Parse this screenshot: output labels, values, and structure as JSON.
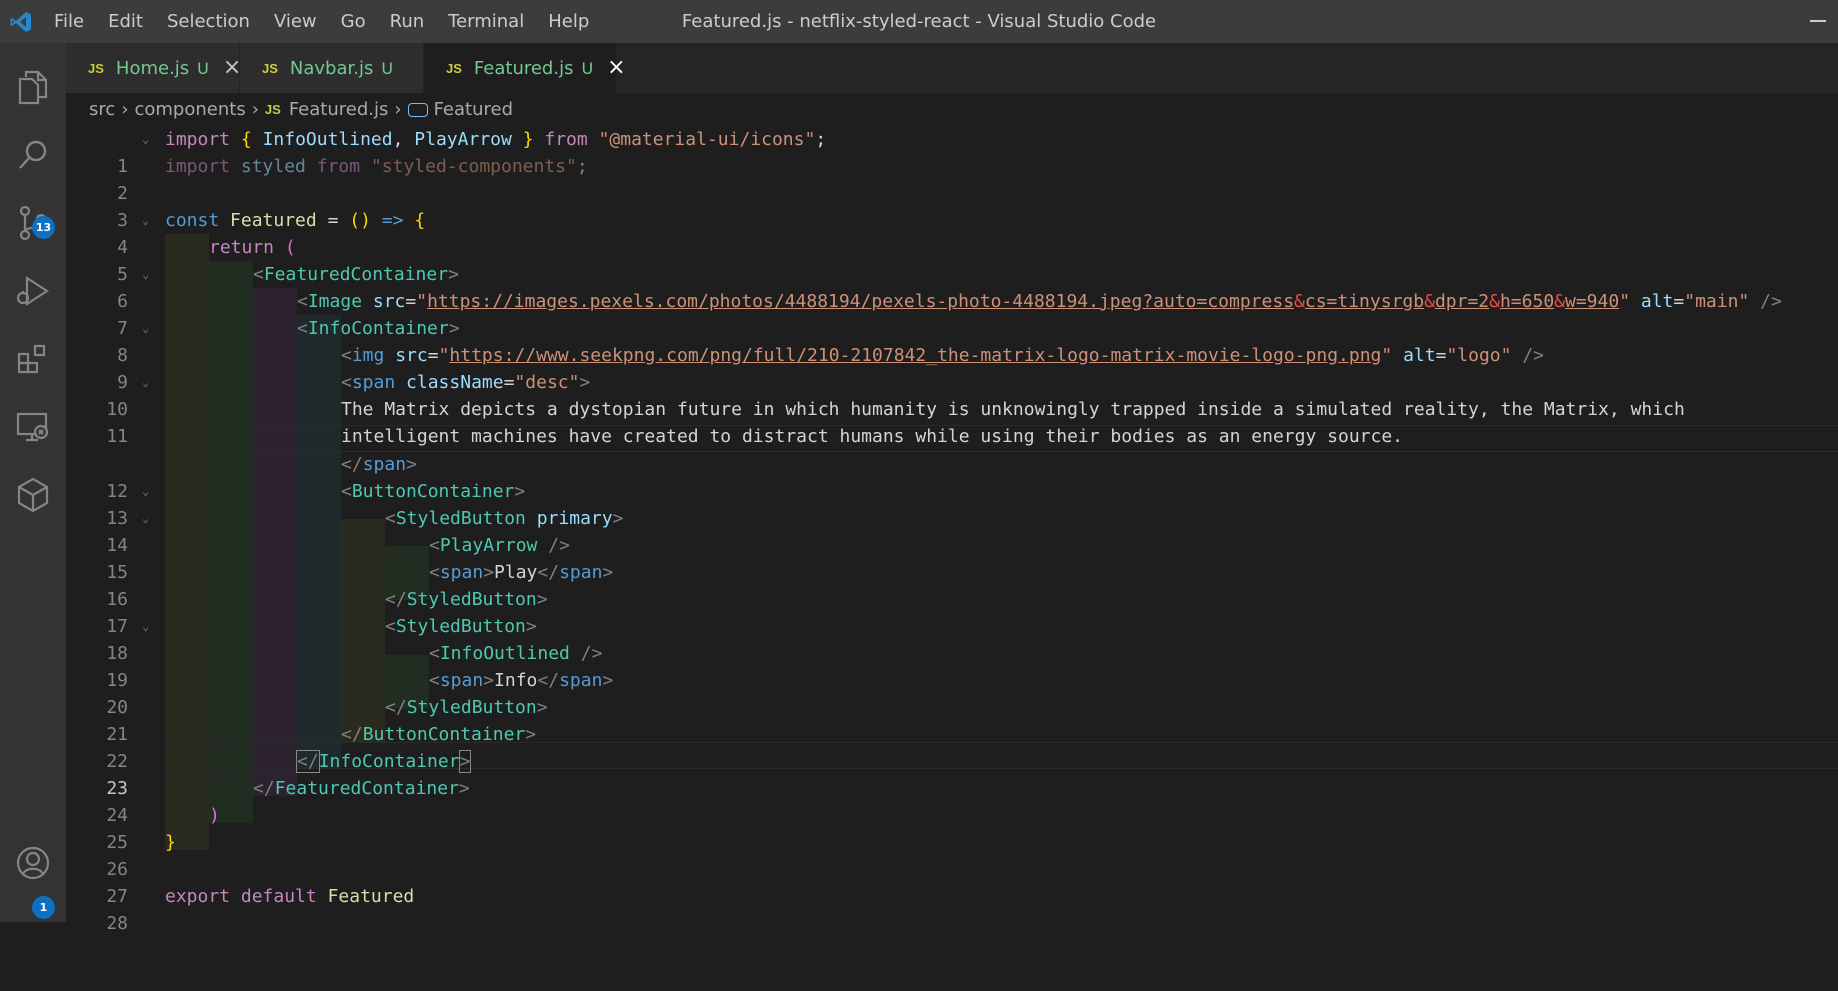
{
  "window": {
    "title": "Featured.js - netflix-styled-react - Visual Studio Code"
  },
  "menu": [
    "File",
    "Edit",
    "Selection",
    "View",
    "Go",
    "Run",
    "Terminal",
    "Help"
  ],
  "activity": {
    "scm_badge": "13",
    "account_badge": "1"
  },
  "tabs": [
    {
      "label": "Home.js",
      "status": "U",
      "close": "×",
      "icon": "JS"
    },
    {
      "label": "Navbar.js",
      "status": "U",
      "icon": "JS"
    },
    {
      "label": "Featured.js",
      "status": "U",
      "close": "×",
      "icon": "JS"
    }
  ],
  "breadcrumb": {
    "parts": [
      "src",
      "components",
      "Featured.js",
      "Featured"
    ],
    "icon": "JS"
  },
  "editor": {
    "line_numbers": [
      "1",
      "2",
      "3",
      "4",
      "5",
      "6",
      "7",
      "8",
      "9",
      "10",
      "11",
      "12",
      "13",
      "14",
      "15",
      "16",
      "17",
      "18",
      "19",
      "20",
      "21",
      "22",
      "23",
      "24",
      "25",
      "26",
      "27",
      "28"
    ],
    "current_line": "23",
    "code": {
      "l1": {
        "import": "import",
        "ob": "{",
        "a": "InfoOutlined",
        "comma": ",",
        "b": "PlayArrow",
        "cb": "}",
        "from": "from",
        "src": "\"@material-ui/icons\"",
        "semi": ";"
      },
      "l2": {
        "import": "import",
        "name": "styled",
        "from": "from",
        "src": "\"styled-components\"",
        "semi": ";"
      },
      "l4": {
        "const": "const",
        "name": "Featured",
        "eq": "=",
        "paren": "()",
        "arrow": "=>",
        "brace": "{"
      },
      "l5": {
        "ret": "return",
        "paren": "("
      },
      "l6": {
        "lt": "<",
        "tag": "FeaturedContainer",
        "gt": ">"
      },
      "l7": {
        "lt": "<",
        "tag": "Image",
        "attr": "src",
        "eq": "=",
        "q1": "\"",
        "u1": "https://images.pexels.com/photos/4488194/pexels-photo-4488194.jpeg?auto=compress",
        "e1": "&",
        "u2": "cs=tinysrgb",
        "e2": "&",
        "u3": "dpr=2",
        "e3": "&",
        "u4": "h=650",
        "e4": "&",
        "u5": "w=940",
        "q2": "\"",
        "attr2": "alt",
        "eq2": "=",
        "val2": "\"main\"",
        "end": "/>"
      },
      "l8": {
        "lt": "<",
        "tag": "InfoContainer",
        "gt": ">"
      },
      "l9": {
        "lt": "<",
        "tag": "img",
        "attr": "src",
        "eq": "=",
        "q1": "\"",
        "url": "https://www.seekpng.com/png/full/210-2107842_the-matrix-logo-matrix-movie-logo-png.png",
        "q2": "\"",
        "attr2": "alt",
        "eq2": "=",
        "val2": "\"logo\"",
        "end": "/>"
      },
      "l10": {
        "lt": "<",
        "tag": "span",
        "attr": "className",
        "eq": "=",
        "val": "\"desc\"",
        "gt": ">"
      },
      "l11a": "The Matrix depicts a dystopian future in which humanity is unknowingly trapped inside a simulated reality, the Matrix, which",
      "l11b": "intelligent machines have created to distract humans while using their bodies as an energy source.",
      "l12": {
        "lt": "</",
        "tag": "span",
        "gt": ">"
      },
      "l13": {
        "lt": "<",
        "tag": "ButtonContainer",
        "gt": ">"
      },
      "l14": {
        "lt": "<",
        "tag": "StyledButton",
        "attr": "primary",
        "gt": ">"
      },
      "l15": {
        "lt": "<",
        "tag": "PlayArrow",
        "end": "/>"
      },
      "l16": {
        "lt": "<",
        "tag": "span",
        "gt": ">",
        "text": "Play",
        "lt2": "</",
        "tag2": "span",
        "gt2": ">"
      },
      "l17": {
        "lt": "</",
        "tag": "StyledButton",
        "gt": ">"
      },
      "l18": {
        "lt": "<",
        "tag": "StyledButton",
        "gt": ">"
      },
      "l19": {
        "lt": "<",
        "tag": "InfoOutlined",
        "end": "/>"
      },
      "l20": {
        "lt": "<",
        "tag": "span",
        "gt": ">",
        "text": "Info",
        "lt2": "</",
        "tag2": "span",
        "gt2": ">"
      },
      "l21": {
        "lt": "</",
        "tag": "StyledButton",
        "gt": ">"
      },
      "l22": {
        "lt": "</",
        "tag": "ButtonContainer",
        "gt": ">"
      },
      "l23": {
        "lt": "</",
        "tag": "InfoContainer",
        "gt": ">"
      },
      "l24": {
        "lt": "</",
        "tag": "FeaturedContainer",
        "gt": ">"
      },
      "l25": {
        "paren": ")"
      },
      "l26": {
        "brace": "}"
      },
      "l28": {
        "export": "export",
        "default": "default",
        "name": "Featured"
      }
    }
  }
}
